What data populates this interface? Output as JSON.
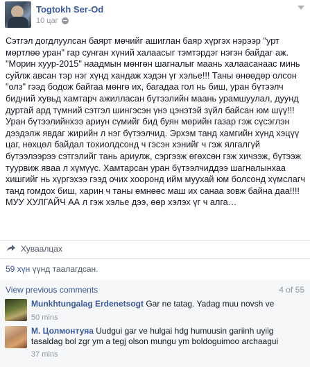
{
  "post": {
    "author": "Togtokh Ser-Od",
    "time": "10 цаг",
    "text": "Сэтгэл догдлуулсан баярт мөчийг ашиглан баяр хүргэх нэрээр \"урт мөртлөө уран\" гар сунган хүний халаасыг тэмтэрдэг нэгэн байдаг аж. \"Морин хуур-2015\" наадмын мөнгөн шагналыг маань халаасанаас минь суйлж авсан тэр нэг хүнд хандаж хэдэн үг хэлье!!! Таны өнөөдөр олсон \"олз\" гээд бодож байгаа мөнгө их, багадаа гол нь биш, уран бүтээлч бидний хувьд хамтарч ажилласан бүтээлийн маань урамшуулал, дуунд дуртай ард түмний сэтгэл шингэсэн үнэ цэнэтэй зүйл байсан юм шүү!!! Уран бүтээлийнхээ ариун сүмийг бид буян мөрийн газар гэж сүсэглэн дээдэлж явдаг жирийн л нэг бүтээлчид. Эрхэм танд хамгийн хүнд хэцүү цаг, нөхцөл байдал тохиолдсонд ч гэсэн хэнийг ч гэж ялгалгүй бүтээлээрээ сэтгэлийг тань ариулж, сэргээж өгөхсөн гэж хичээж, бүтээж туурвиж явaa л хүмүүс. Хамтарсан уран бүтээлчиддээ шагналынхаа хишгийг нь хүргэхээ гээд очих хооронд ийм муухай юм болсонд хүмслагч танд гомдох биш, харин ч таны өмнөөс маш их санаа зовж байна даа!!!! МУУ ХУЛГАЙЧ АА л гэж хэлье дээ, өөр хэлэх үг ч алга…"
  },
  "actions": {
    "share_label": "Хуваалцах"
  },
  "likes": {
    "count_text": "59 хүн",
    "suffix": " үүнд таалагдсан."
  },
  "comments": {
    "view_previous": "View previous comments",
    "counter": "4 of 55",
    "items": [
      {
        "name": "Munkhtungalag Erdenetsogt",
        "text": " Gar ne tatag. Yadag muu novsh ve",
        "time": "50 mins"
      },
      {
        "name": "М. Цолмонтуяа",
        "text": " Uudgui gar ve hulgai hdg humuusin gariinh uyiig tasaldag bol zgr ym a tegj olson mungu ym boldoguimoo archaaguі",
        "time": "37 mins"
      }
    ]
  },
  "colors": {
    "link": "#3b5998",
    "meta": "#9197a3",
    "text": "#141823"
  }
}
